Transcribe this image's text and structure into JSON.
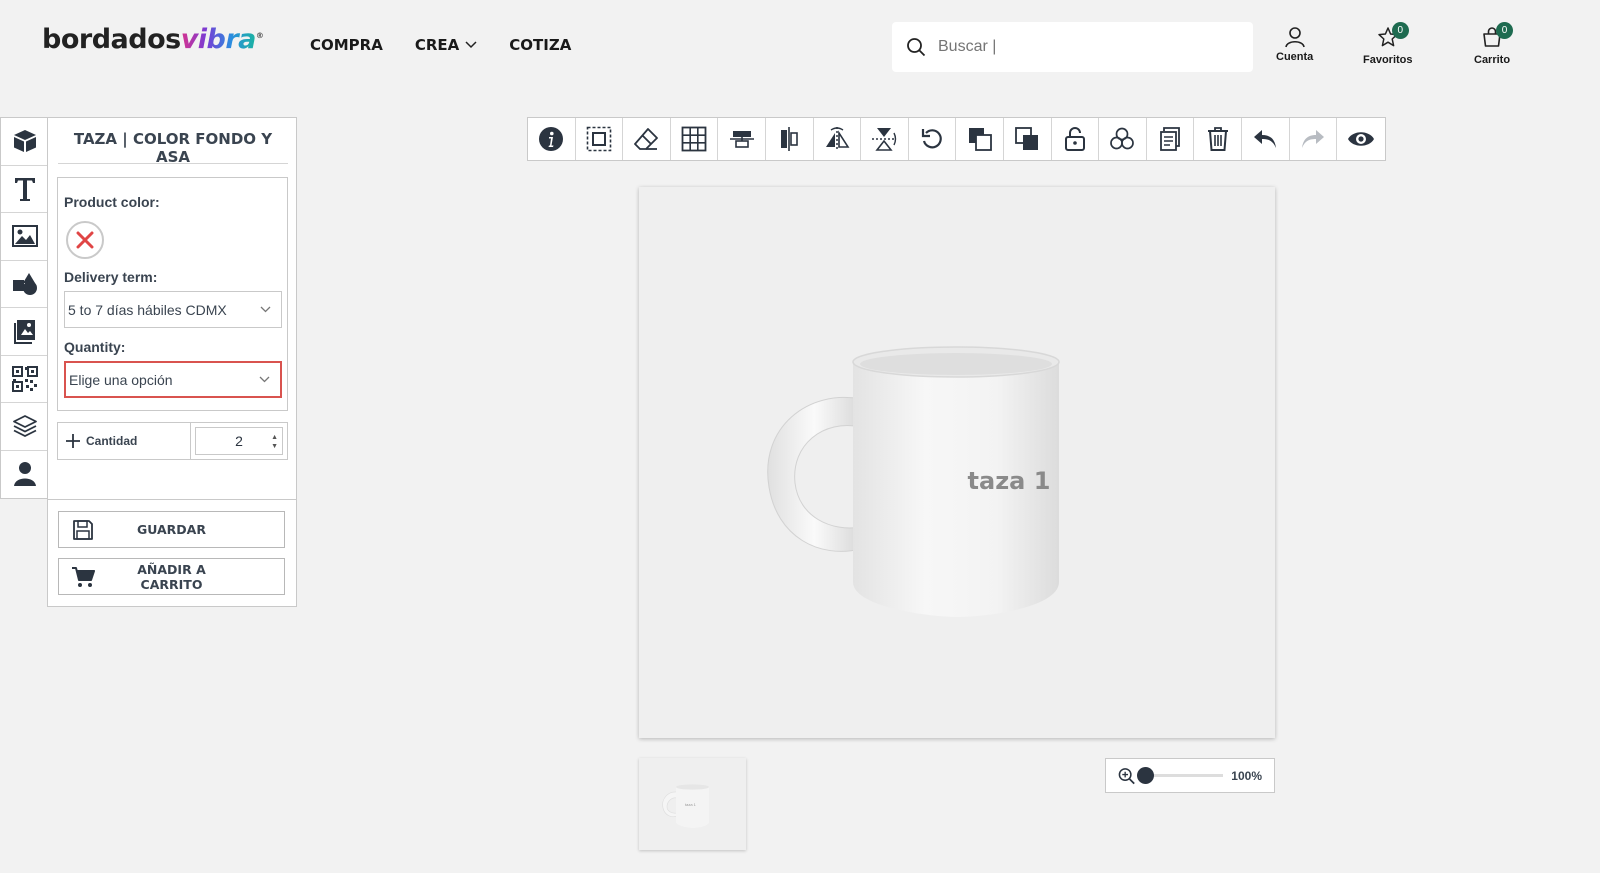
{
  "header": {
    "logo_part1": "bordados",
    "logo_part2": "vibra",
    "logo_mark": "®",
    "nav": [
      {
        "label": "COMPRA"
      },
      {
        "label": "CREA"
      },
      {
        "label": "COTIZA"
      }
    ],
    "search_placeholder": "Buscar |",
    "account_label": "Cuenta",
    "favorites_label": "Favoritos",
    "favorites_count": "0",
    "cart_label": "Carrito",
    "cart_count": "0"
  },
  "left_tools": [
    "product-icon",
    "text-icon",
    "image-icon",
    "shapes-icon",
    "clipart-icon",
    "qrcode-icon",
    "layers-icon",
    "user-icon"
  ],
  "panel": {
    "title": "TAZA | COLOR FONDO Y ASA",
    "product_color_label": "Product color:",
    "delivery_label": "Delivery term:",
    "delivery_value": "5 to 7 días hábiles CDMX",
    "quantity_label": "Quantity:",
    "quantity_value": "Elige una opción",
    "cantidad_label": "Cantidad",
    "cantidad_value": "2",
    "save_label": "GUARDAR",
    "add_cart_label": "AÑADIR A CARRITO"
  },
  "toolbar": [
    "info-icon",
    "select-all-icon",
    "eraser-icon",
    "grid-icon",
    "align-horizontal-icon",
    "align-vertical-icon",
    "flip-horizontal-icon",
    "flip-vertical-icon",
    "rotate-icon",
    "send-backward-icon",
    "bring-forward-icon",
    "lock-icon",
    "group-icon",
    "duplicate-icon",
    "delete-icon",
    "undo-icon",
    "redo-icon",
    "preview-icon"
  ],
  "canvas": {
    "mug_text": "taza 1",
    "thumb_text": "taza 1"
  },
  "zoom": {
    "value": "100%",
    "level": 0.0
  },
  "colors": {
    "badge": "#1e6b50",
    "error_border": "#d9534f",
    "swatch_x": "#e04545",
    "icon_dark": "#2b3440"
  }
}
